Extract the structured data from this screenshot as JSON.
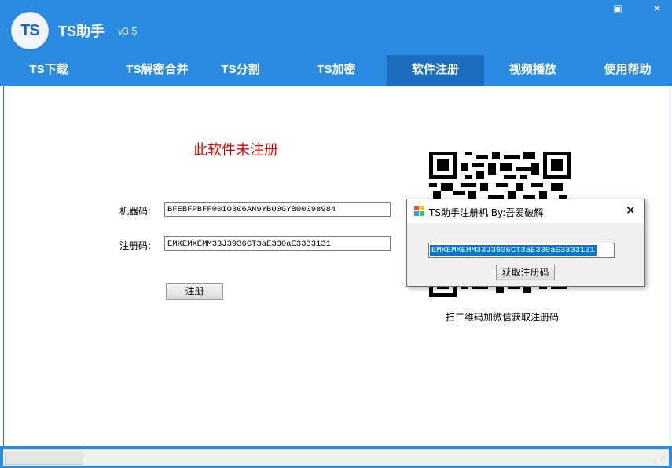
{
  "app": {
    "logo_text": "TS",
    "title": "TS助手",
    "version": "v3.5",
    "minimize_glyph": "▣",
    "close_glyph": "✕"
  },
  "tabs": [
    {
      "label": "TS下载",
      "active": false
    },
    {
      "label": "TS解密合并",
      "active": false
    },
    {
      "label": "TS分割",
      "active": false
    },
    {
      "label": "TS加密",
      "active": false
    },
    {
      "label": "软件注册",
      "active": true
    },
    {
      "label": "视频播放",
      "active": false
    },
    {
      "label": "使用帮助",
      "active": false
    }
  ],
  "register": {
    "status_text": "此软件未注册",
    "machine_label": "机器码:",
    "machine_value": "BFEBFPBFF00IO306AN9YB00GYB00098984",
    "code_label": "注册码:",
    "code_value": "EMKEMXEMM33J3936CT3aE330aE3333131",
    "register_button": "注册",
    "qr_caption": "扫二维码加微信获取注册码"
  },
  "dialog": {
    "title": "TS助手注册机 By:吾爱破解",
    "close_glyph": "✕",
    "code_value": "EMKEMXEMM33J3936CT3aE330aE3333131",
    "get_button": "获取注册码"
  },
  "colors": {
    "titlebar": "#2a8be0",
    "active_tab": "#1c6dc0",
    "unregistered_text": "#e00000",
    "selection": "#0078d7"
  }
}
